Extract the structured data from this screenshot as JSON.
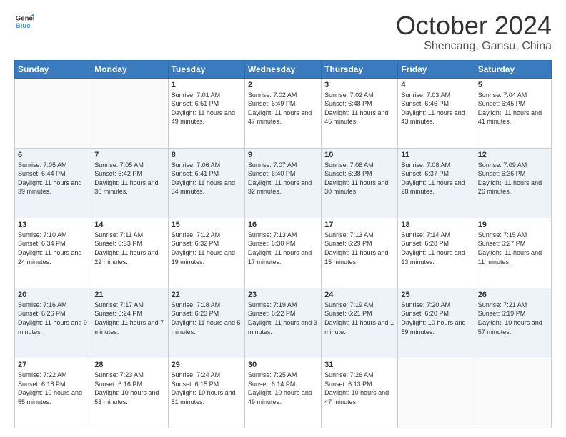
{
  "header": {
    "logo_line1": "General",
    "logo_line2": "Blue",
    "month": "October 2024",
    "location": "Shencang, Gansu, China"
  },
  "weekdays": [
    "Sunday",
    "Monday",
    "Tuesday",
    "Wednesday",
    "Thursday",
    "Friday",
    "Saturday"
  ],
  "weeks": [
    [
      {
        "day": "",
        "info": ""
      },
      {
        "day": "",
        "info": ""
      },
      {
        "day": "1",
        "info": "Sunrise: 7:01 AM\nSunset: 6:51 PM\nDaylight: 11 hours and 49 minutes."
      },
      {
        "day": "2",
        "info": "Sunrise: 7:02 AM\nSunset: 6:49 PM\nDaylight: 11 hours and 47 minutes."
      },
      {
        "day": "3",
        "info": "Sunrise: 7:02 AM\nSunset: 6:48 PM\nDaylight: 11 hours and 45 minutes."
      },
      {
        "day": "4",
        "info": "Sunrise: 7:03 AM\nSunset: 6:46 PM\nDaylight: 11 hours and 43 minutes."
      },
      {
        "day": "5",
        "info": "Sunrise: 7:04 AM\nSunset: 6:45 PM\nDaylight: 11 hours and 41 minutes."
      }
    ],
    [
      {
        "day": "6",
        "info": "Sunrise: 7:05 AM\nSunset: 6:44 PM\nDaylight: 11 hours and 39 minutes."
      },
      {
        "day": "7",
        "info": "Sunrise: 7:05 AM\nSunset: 6:42 PM\nDaylight: 11 hours and 36 minutes."
      },
      {
        "day": "8",
        "info": "Sunrise: 7:06 AM\nSunset: 6:41 PM\nDaylight: 11 hours and 34 minutes."
      },
      {
        "day": "9",
        "info": "Sunrise: 7:07 AM\nSunset: 6:40 PM\nDaylight: 11 hours and 32 minutes."
      },
      {
        "day": "10",
        "info": "Sunrise: 7:08 AM\nSunset: 6:38 PM\nDaylight: 11 hours and 30 minutes."
      },
      {
        "day": "11",
        "info": "Sunrise: 7:08 AM\nSunset: 6:37 PM\nDaylight: 11 hours and 28 minutes."
      },
      {
        "day": "12",
        "info": "Sunrise: 7:09 AM\nSunset: 6:36 PM\nDaylight: 11 hours and 26 minutes."
      }
    ],
    [
      {
        "day": "13",
        "info": "Sunrise: 7:10 AM\nSunset: 6:34 PM\nDaylight: 11 hours and 24 minutes."
      },
      {
        "day": "14",
        "info": "Sunrise: 7:11 AM\nSunset: 6:33 PM\nDaylight: 11 hours and 22 minutes."
      },
      {
        "day": "15",
        "info": "Sunrise: 7:12 AM\nSunset: 6:32 PM\nDaylight: 11 hours and 19 minutes."
      },
      {
        "day": "16",
        "info": "Sunrise: 7:13 AM\nSunset: 6:30 PM\nDaylight: 11 hours and 17 minutes."
      },
      {
        "day": "17",
        "info": "Sunrise: 7:13 AM\nSunset: 6:29 PM\nDaylight: 11 hours and 15 minutes."
      },
      {
        "day": "18",
        "info": "Sunrise: 7:14 AM\nSunset: 6:28 PM\nDaylight: 11 hours and 13 minutes."
      },
      {
        "day": "19",
        "info": "Sunrise: 7:15 AM\nSunset: 6:27 PM\nDaylight: 11 hours and 11 minutes."
      }
    ],
    [
      {
        "day": "20",
        "info": "Sunrise: 7:16 AM\nSunset: 6:26 PM\nDaylight: 11 hours and 9 minutes."
      },
      {
        "day": "21",
        "info": "Sunrise: 7:17 AM\nSunset: 6:24 PM\nDaylight: 11 hours and 7 minutes."
      },
      {
        "day": "22",
        "info": "Sunrise: 7:18 AM\nSunset: 6:23 PM\nDaylight: 11 hours and 5 minutes."
      },
      {
        "day": "23",
        "info": "Sunrise: 7:19 AM\nSunset: 6:22 PM\nDaylight: 11 hours and 3 minutes."
      },
      {
        "day": "24",
        "info": "Sunrise: 7:19 AM\nSunset: 6:21 PM\nDaylight: 11 hours and 1 minute."
      },
      {
        "day": "25",
        "info": "Sunrise: 7:20 AM\nSunset: 6:20 PM\nDaylight: 10 hours and 59 minutes."
      },
      {
        "day": "26",
        "info": "Sunrise: 7:21 AM\nSunset: 6:19 PM\nDaylight: 10 hours and 57 minutes."
      }
    ],
    [
      {
        "day": "27",
        "info": "Sunrise: 7:22 AM\nSunset: 6:18 PM\nDaylight: 10 hours and 55 minutes."
      },
      {
        "day": "28",
        "info": "Sunrise: 7:23 AM\nSunset: 6:16 PM\nDaylight: 10 hours and 53 minutes."
      },
      {
        "day": "29",
        "info": "Sunrise: 7:24 AM\nSunset: 6:15 PM\nDaylight: 10 hours and 51 minutes."
      },
      {
        "day": "30",
        "info": "Sunrise: 7:25 AM\nSunset: 6:14 PM\nDaylight: 10 hours and 49 minutes."
      },
      {
        "day": "31",
        "info": "Sunrise: 7:26 AM\nSunset: 6:13 PM\nDaylight: 10 hours and 47 minutes."
      },
      {
        "day": "",
        "info": ""
      },
      {
        "day": "",
        "info": ""
      }
    ]
  ]
}
